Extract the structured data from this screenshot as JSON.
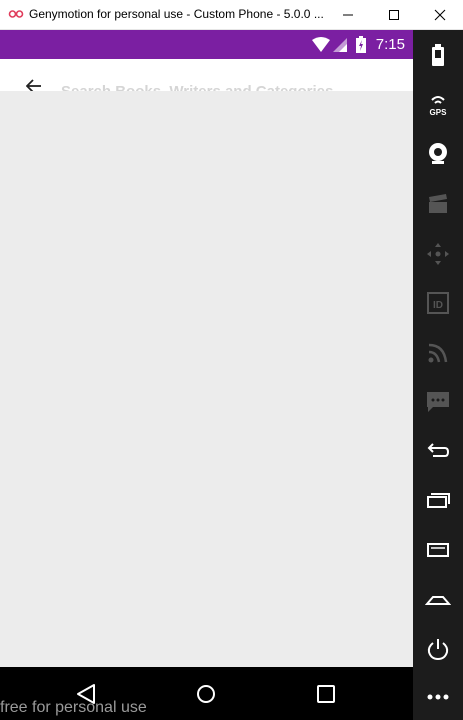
{
  "window": {
    "title": "Genymotion for personal use - Custom Phone - 5.0.0 ...",
    "minimize_icon": "minimize-icon",
    "maximize_icon": "maximize-icon",
    "close_icon": "close-icon"
  },
  "statusbar": {
    "time": "7:15",
    "color": "#7b1fa2",
    "icons": [
      "wifi-icon",
      "signal-icon",
      "battery-icon"
    ]
  },
  "search": {
    "placeholder": "Search Books, Writers and Categories",
    "value": ""
  },
  "sidepanel": {
    "items": [
      "battery",
      "gps",
      "camera",
      "media",
      "dpad",
      "id",
      "rss",
      "sms",
      "back",
      "recent",
      "menu",
      "home",
      "power",
      "more"
    ]
  },
  "navbar": {
    "items": [
      "back",
      "home",
      "recents"
    ]
  },
  "watermark": "free for personal use"
}
